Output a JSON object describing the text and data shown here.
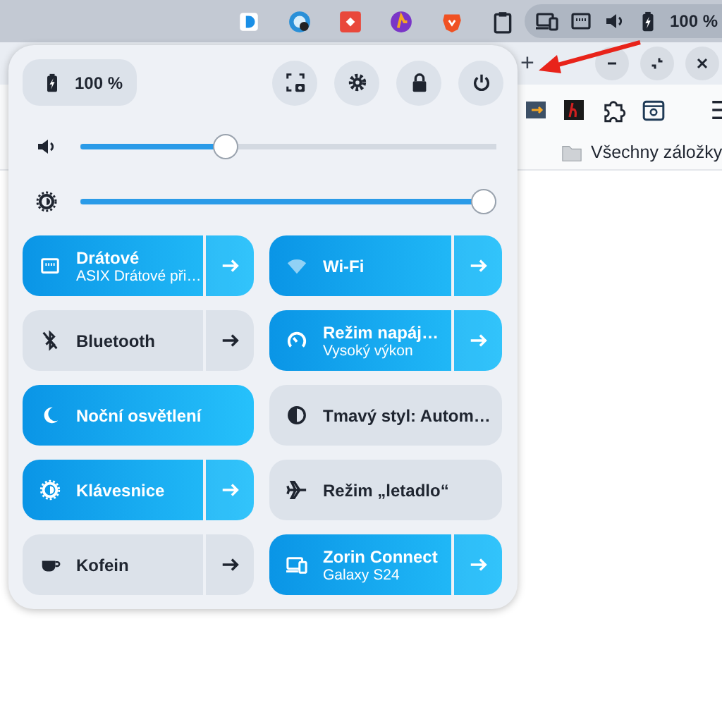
{
  "top_bar": {
    "battery_reading": "100 %"
  },
  "browser": {
    "new_tab": "+",
    "bookmark_folder": "Všechny záložky"
  },
  "quick_settings": {
    "battery": "100 %",
    "sliders": [
      {
        "kind": "volume",
        "level": 0.34
      },
      {
        "kind": "brightness",
        "level": 1.0
      }
    ],
    "toggles": [
      {
        "title": "Drátové",
        "subtitle": "ASIX Drátové při…",
        "on": true,
        "kind": "split"
      },
      {
        "title": "Wi-Fi",
        "on": true,
        "kind": "split"
      },
      {
        "title": "Bluetooth",
        "on": false,
        "kind": "split"
      },
      {
        "title": "Režim napáj…",
        "subtitle": "Vysoký výkon",
        "on": true,
        "kind": "split"
      },
      {
        "title": "Noční osvětlení",
        "on": true,
        "kind": "plain"
      },
      {
        "title": "Tmavý styl: Autom…",
        "on": false,
        "kind": "plain"
      },
      {
        "title": "Klávesnice",
        "on": true,
        "kind": "split"
      },
      {
        "title": "Režim „letadlo“",
        "on": false,
        "kind": "plain"
      },
      {
        "title": "Kofein",
        "on": false,
        "kind": "split"
      },
      {
        "title": "Zorin Connect",
        "subtitle": "Galaxy S24",
        "on": true,
        "kind": "split"
      }
    ]
  }
}
